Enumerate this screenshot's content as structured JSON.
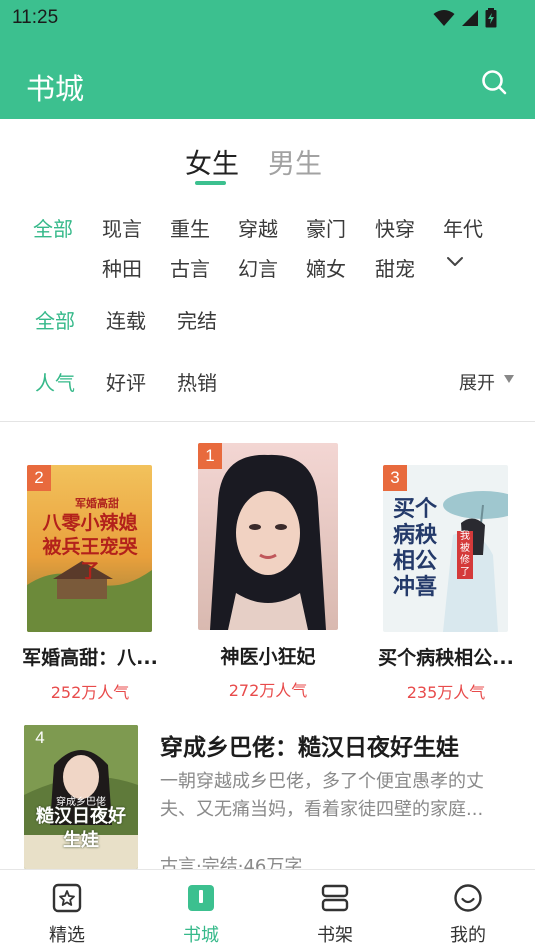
{
  "status_bar": {
    "time": "11:25"
  },
  "header": {
    "title": "书城",
    "search_icon": "search-icon"
  },
  "gender_tabs": [
    {
      "label": "女生",
      "active": true
    },
    {
      "label": "男生",
      "active": false
    }
  ],
  "categories": {
    "row1": [
      "全部",
      "现言",
      "重生",
      "穿越",
      "豪门",
      "快穿",
      "年代"
    ],
    "row2": [
      "种田",
      "古言",
      "幻言",
      "嫡女",
      "甜宠"
    ],
    "selected": "全部",
    "expand_icon": "chevron-down-icon"
  },
  "status_filters": {
    "items": [
      "全部",
      "连载",
      "完结"
    ],
    "selected": "全部"
  },
  "sort_filters": {
    "items": [
      "人气",
      "好评",
      "热销"
    ],
    "selected": "人气",
    "expand_label": "展开"
  },
  "podium": [
    {
      "rank": "2",
      "title": "军婚高甜：八...",
      "popularity": "252万人气",
      "cover_text": "八零小辣媳被兵王宠哭了",
      "cover_tag": "军婚高甜"
    },
    {
      "rank": "1",
      "title": "神医小狂妃",
      "popularity": "272万人气"
    },
    {
      "rank": "3",
      "title": "买个病秧相公...",
      "popularity": "235万人气",
      "cover_text": "买个病秧相公冲喜",
      "cover_tag": "我被修了"
    }
  ],
  "list": [
    {
      "rank": "4",
      "title": "穿成乡巴佬：糙汉日夜好生娃",
      "description": "一朝穿越成乡巴佬，多了个便宜愚孝的丈夫、又无痛当妈，看着家徒四壁的家庭...",
      "meta": "古言·完结·46万字",
      "cover_tag": "穿成乡巴佬",
      "cover_text": "糙汉日夜好生娃"
    }
  ],
  "bottom_nav": [
    {
      "label": "精选",
      "icon": "star-frame-icon",
      "active": false
    },
    {
      "label": "书城",
      "icon": "book-icon",
      "active": true
    },
    {
      "label": "书架",
      "icon": "shelf-icon",
      "active": false
    },
    {
      "label": "我的",
      "icon": "smile-face-icon",
      "active": false
    }
  ],
  "colors": {
    "accent": "#3cc08f",
    "popularity": "#e84b4b",
    "rank_badge": "#e86a3d"
  }
}
